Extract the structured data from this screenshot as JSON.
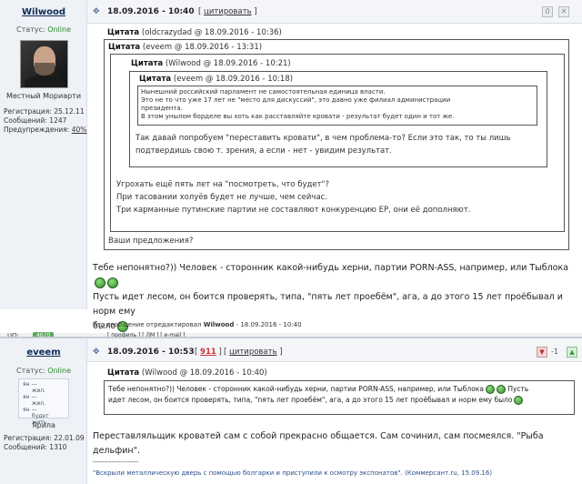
{
  "post1": {
    "username": "Wilwood",
    "status_label": "Статус:",
    "status_value": "Online",
    "user_title": "Местный Мориарти",
    "stats": {
      "reg_label": "Регистрация:",
      "reg_value": "25.12.11",
      "msgs_label": "Сообщений:",
      "msgs_value": "1247",
      "warn_label": "Предупреждения:",
      "warn_value": "40%"
    },
    "date": "18.09.2016 - 10:40",
    "quote_link": "цитировать",
    "quote_outer": {
      "author": "Цитата",
      "meta": "(oldcrazydad @ 18.09.2016 - 10:36)",
      "text": "Ваши предложения?"
    },
    "quote_2": {
      "author": "Цитата",
      "meta": "(eveem @ 18.09.2016 - 13:31)",
      "lines": [
        "Угрохать ещё пять лет на \"посмотреть, что будет\"?",
        "При тасовании холуёв будет не лучше, чем сейчас.",
        "Три карманные путинские партии не составляют конкуренцию ЕР, они её дополняют."
      ]
    },
    "quote_3": {
      "author": "Цитата",
      "meta": "(Wilwood @ 18.09.2016 - 10:21)",
      "lines": [
        "Так давай попробуем \"переставить кровати\", в чем проблема-то? Если это так, то ты лишь",
        "подтвердишь свою т. зрения, а если - нет - увидим результат."
      ]
    },
    "quote_4": {
      "author": "Цитата",
      "meta": "(eveem @ 18.09.2016 - 10:18)",
      "lines": [
        "Нынешний российский парламент не самостоятельная единица власти.",
        "Это не то что уже 17 лет не \"место для дискуссий\", это давно уже филиал администрации",
        "президента.",
        "В этом унылом борделе вы хоть как расставляйте кровати - результат будет один и тот же."
      ]
    },
    "body_lines": [
      "Тебе непонятно?)) Человек - сторонник какой-нибудь херни, партии PORN-ASS, например, или Тыблока",
      "Пусть идет лесом, он боится проверять, типа, \"пять лет проебём\", ага, а до этого 15 лет проёбывал и норм ему",
      "было"
    ],
    "edited": {
      "prefix": "Это сообщение отредактировал",
      "author": "Wilwood",
      "date": "- 18.09.2016 - 10:40"
    }
  },
  "footer1": {
    "uo": "UO:",
    "badge": "4670",
    "links": "[ профиль ] [ ЛМ ] [ e-mail ]"
  },
  "post2": {
    "username": "eveem",
    "status_label": "Статус:",
    "status_value": "Online",
    "meme_lines": [
      "ян —",
      "жил.",
      "ян —",
      "жил.",
      "ян —",
      "будет жить."
    ],
    "user_title": "Ярила",
    "stats": {
      "reg_label": "Регистрация:",
      "reg_value": "22.01.09",
      "msgs_label": "Сообщений:",
      "msgs_value": "1310"
    },
    "date": "18.09.2016 - 10:53",
    "rating": "911",
    "quote_link": "цитировать",
    "rating_value": "-1",
    "quote": {
      "author": "Цитата",
      "meta": "(Wilwood @ 18.09.2016 - 10:40)",
      "line1": "Тебе непонятно?)) Человек - сторонник какой-нибудь херни, партии PORN-ASS, например, или Тыблока",
      "line1b": "Пусть",
      "line2": "идет лесом, он боится проверять, типа, \"пять лет проебём\", ага, а до этого 15 лет проёбывал и норм ему было"
    },
    "body": "Переставляльщик кроватей сам с собой прекрасно общается. Сам сочинил, сам посмеялся. \"Рыба дельфин\".",
    "sig_dashes": "--------------------",
    "sig_quote": "\"Вскрыли металлическую дверь с помощью болгарки и приступили к осмотру экспонатов\".",
    "sig_source": "(Коммерсант.ru, 15.09.16)"
  }
}
